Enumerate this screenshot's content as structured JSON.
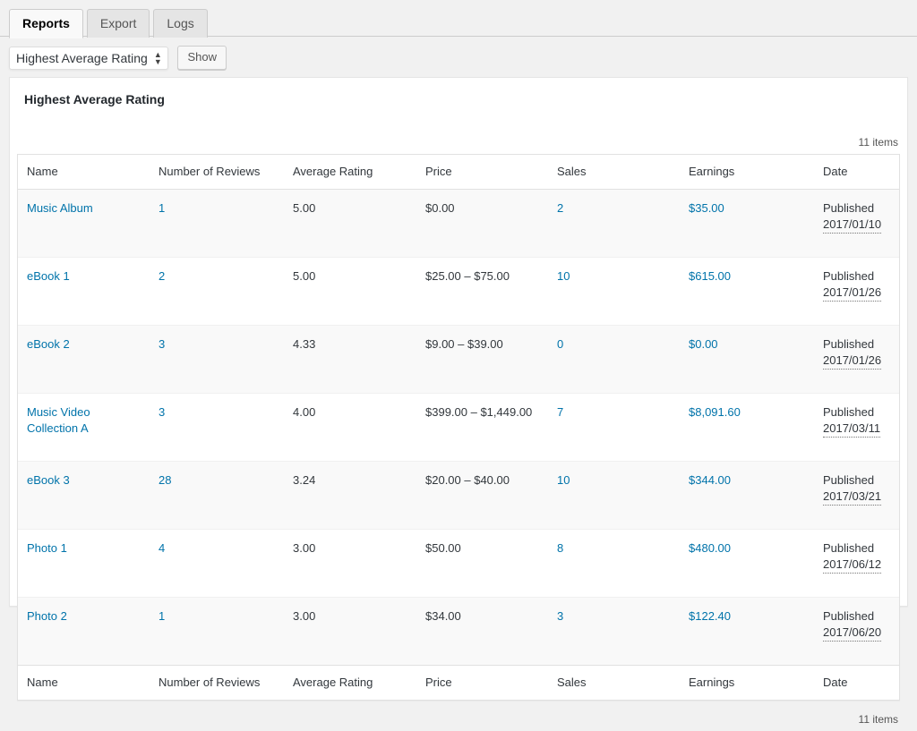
{
  "tabs": [
    {
      "label": "Reports",
      "active": true
    },
    {
      "label": "Export",
      "active": false
    },
    {
      "label": "Logs",
      "active": false
    }
  ],
  "toolbar": {
    "report_select_value": "Highest Average Rating",
    "show_button_label": "Show"
  },
  "panel": {
    "title": "Highest Average Rating",
    "items_count_top": "11 items",
    "items_count_bottom": "11 items"
  },
  "table": {
    "columns": [
      "Name",
      "Number of Reviews",
      "Average Rating",
      "Price",
      "Sales",
      "Earnings",
      "Date"
    ],
    "rows": [
      {
        "name": "Music Album",
        "reviews": "1",
        "rating": "5.00",
        "price": "$0.00",
        "sales": "2",
        "earnings": "$35.00",
        "date_status": "Published",
        "date_value": "2017/01/10"
      },
      {
        "name": "eBook 1",
        "reviews": "2",
        "rating": "5.00",
        "price": "$25.00 – $75.00",
        "sales": "10",
        "earnings": "$615.00",
        "date_status": "Published",
        "date_value": "2017/01/26"
      },
      {
        "name": "eBook 2",
        "reviews": "3",
        "rating": "4.33",
        "price": "$9.00 – $39.00",
        "sales": "0",
        "earnings": "$0.00",
        "date_status": "Published",
        "date_value": "2017/01/26"
      },
      {
        "name": "Music Video Collection A",
        "reviews": "3",
        "rating": "4.00",
        "price": "$399.00 – $1,449.00",
        "sales": "7",
        "earnings": "$8,091.60",
        "date_status": "Published",
        "date_value": "2017/03/11"
      },
      {
        "name": "eBook 3",
        "reviews": "28",
        "rating": "3.24",
        "price": "$20.00 – $40.00",
        "sales": "10",
        "earnings": "$344.00",
        "date_status": "Published",
        "date_value": "2017/03/21"
      },
      {
        "name": "Photo 1",
        "reviews": "4",
        "rating": "3.00",
        "price": "$50.00",
        "sales": "8",
        "earnings": "$480.00",
        "date_status": "Published",
        "date_value": "2017/06/12"
      },
      {
        "name": "Photo 2",
        "reviews": "1",
        "rating": "3.00",
        "price": "$34.00",
        "sales": "3",
        "earnings": "$122.40",
        "date_status": "Published",
        "date_value": "2017/06/20"
      }
    ]
  },
  "colors": {
    "link": "#0073aa",
    "text": "#32373c",
    "page_bg": "#f1f1f1",
    "stripe": "#f9f9f9"
  },
  "icons": {
    "select_arrow_up": "▲",
    "select_arrow_down": "▼"
  }
}
